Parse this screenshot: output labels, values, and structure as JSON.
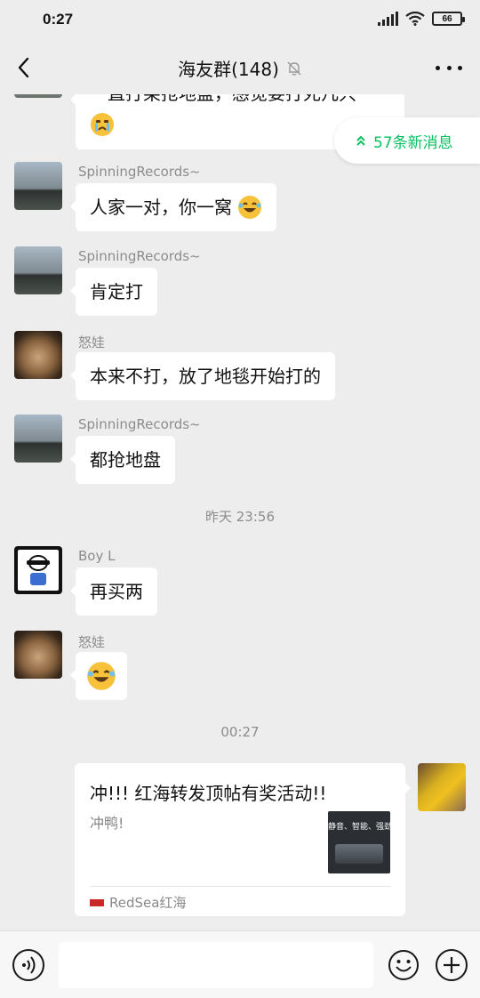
{
  "status_bar": {
    "time": "0:27",
    "battery": "66"
  },
  "header": {
    "title": "海友群(148)"
  },
  "new_messages_label": "57条新消息",
  "messages": [
    {
      "sender": "",
      "text": "一直打架抢地盘，感觉要打死几只"
    },
    {
      "sender": "SpinningRecords~",
      "text": "人家一对，你一窝"
    },
    {
      "sender": "SpinningRecords~",
      "text": "肯定打"
    },
    {
      "sender": "怒娃",
      "text": "本来不打，放了地毯开始打的"
    },
    {
      "sender": "SpinningRecords~",
      "text": "都抢地盘"
    },
    {
      "sender": "Boy L",
      "text": "再买两"
    },
    {
      "sender": "怒娃",
      "text": ""
    }
  ],
  "timestamps": [
    "昨天 23:56",
    "00:27"
  ],
  "share_card": {
    "title": "冲!!! 红海转发顶帖有奖活动!!",
    "description": "冲鸭!",
    "thumb_text": "静音、智能、强劲",
    "source": "RedSea红海"
  },
  "icons": {
    "back": "back-arrow-icon",
    "mute": "muted-bell-icon",
    "more": "more-dots-icon",
    "voice": "voice-input-icon",
    "emoji": "emoji-icon",
    "plus": "plus-icon"
  },
  "colors": {
    "accent": "#07c160",
    "background": "#ededed",
    "bubble": "#ffffff"
  }
}
